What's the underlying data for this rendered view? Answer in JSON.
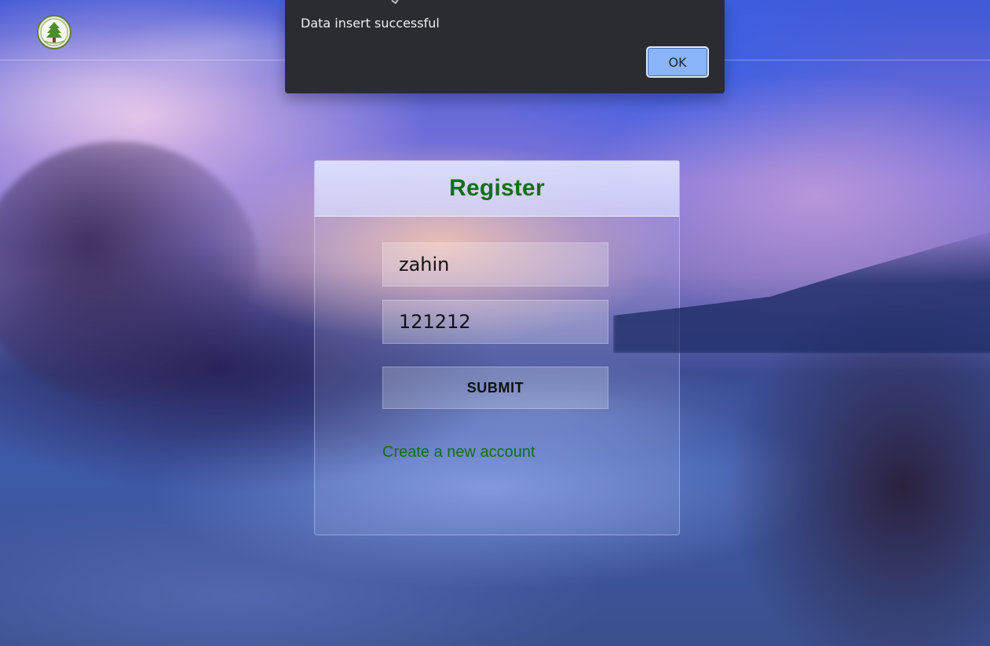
{
  "alert": {
    "message": "Data insert successful",
    "ok_label": "OK"
  },
  "register": {
    "title": "Register",
    "username_value": "zahin",
    "password_value": "121212",
    "submit_label": "SUBMIT",
    "create_account_label": "Create a new account"
  },
  "colors": {
    "title": "#0f7011",
    "link": "#0e6f18",
    "dialog_bg": "#2b2c31",
    "ok_button": "#8ab4f8"
  },
  "icons": {
    "logo": "institution-logo"
  }
}
